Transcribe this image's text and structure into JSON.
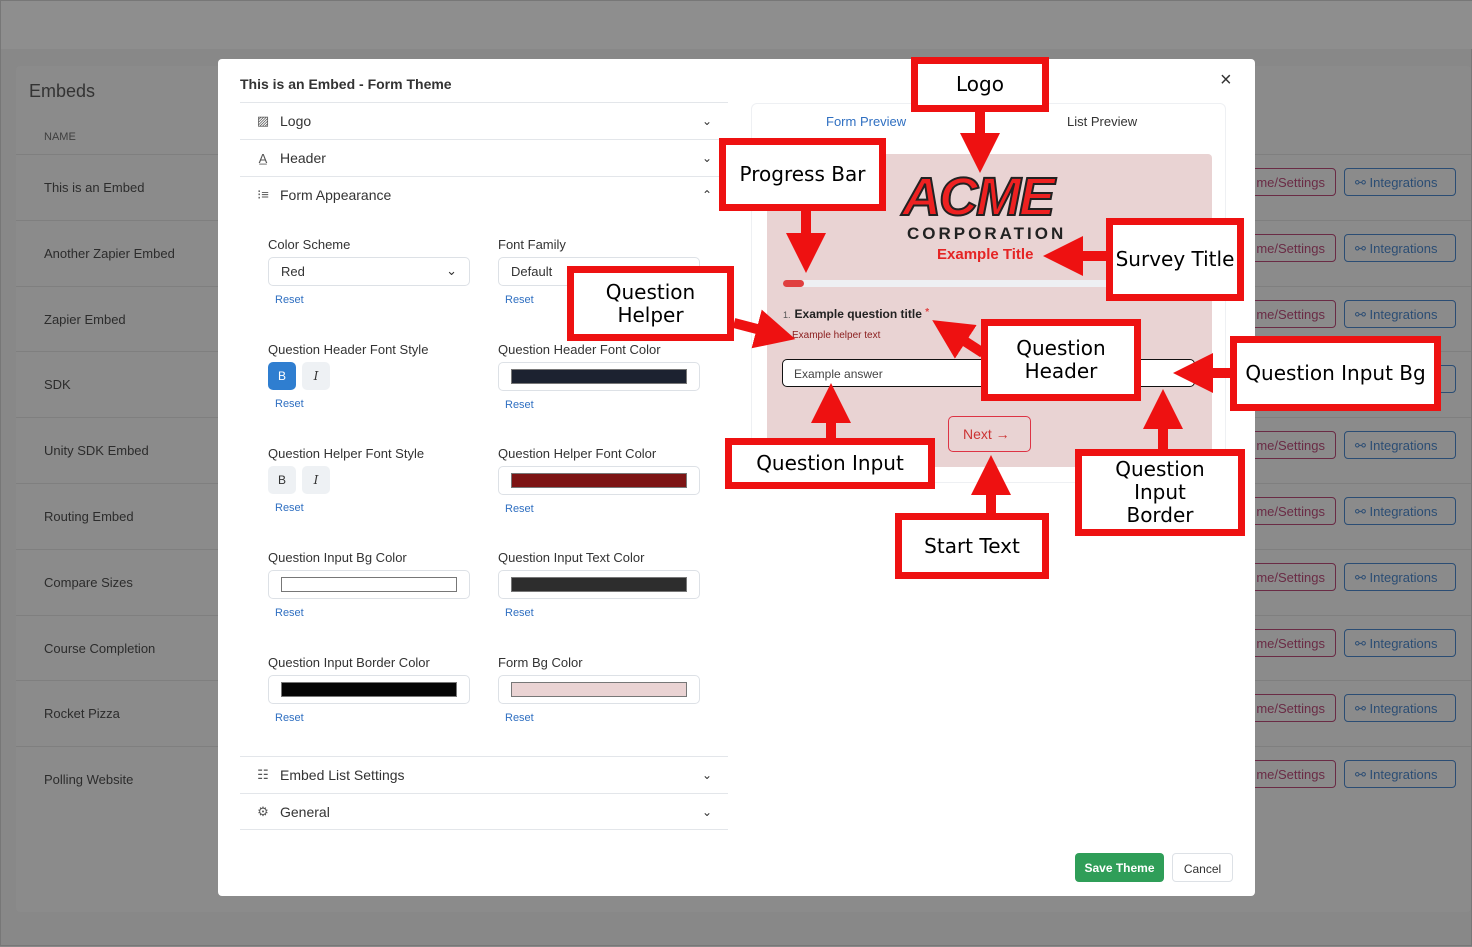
{
  "background": {
    "title": "Embeds",
    "column_name": "NAME",
    "rows": [
      "This is an Embed",
      "Another Zapier Embed",
      "Zapier Embed",
      "SDK",
      "Unity SDK Embed",
      "Routing Embed",
      "Compare Sizes",
      "Course Completion",
      "Rocket Pizza",
      "Polling Website"
    ],
    "theme_button": "me/Settings",
    "integrations_button": "Integrations"
  },
  "modal": {
    "title": "This is an Embed - Form Theme",
    "close": "×",
    "sections": [
      {
        "label": "Logo",
        "icon": "image-icon",
        "chev": "⌄"
      },
      {
        "label": "Header",
        "icon": "text-icon",
        "chev": "⌄"
      },
      {
        "label": "Form Appearance",
        "icon": "form-icon",
        "chev": "⌃"
      },
      {
        "label": "Embed List Settings",
        "icon": "list-icon",
        "chev": "⌄"
      },
      {
        "label": "General",
        "icon": "gear-icon",
        "chev": "⌄"
      }
    ],
    "reset": "Reset",
    "color_scheme": {
      "label": "Color Scheme",
      "value": "Red"
    },
    "font_family": {
      "label": "Font Family",
      "value": "Default"
    },
    "qh_style": {
      "label": "Question Header Font Style",
      "bold": "B",
      "italic": "I",
      "bold_on": true
    },
    "qh_color": {
      "label": "Question Header Font Color",
      "color": "#1c2230"
    },
    "qhelp_style": {
      "label": "Question Helper Font Style",
      "bold": "B",
      "italic": "I",
      "bold_on": false
    },
    "qhelp_color": {
      "label": "Question Helper Font Color",
      "color": "#7d1414"
    },
    "qin_bg": {
      "label": "Question Input Bg Color",
      "color": "#ffffff"
    },
    "qin_text": {
      "label": "Question Input Text Color",
      "color": "#2d2d2d"
    },
    "qin_border": {
      "label": "Question Input Border Color",
      "color": "#050505"
    },
    "form_bg": {
      "label": "Form Bg Color",
      "color": "#ead3d3"
    },
    "save": "Save Theme",
    "cancel": "Cancel"
  },
  "preview": {
    "tabs": [
      "Form Preview",
      "List Preview"
    ],
    "active_tab": "Form Preview",
    "logo": "ACME",
    "logo_sub": "CORPORATION",
    "title": "Example Title",
    "progress": 0.05,
    "question_number": "1.",
    "question_title": "Example question title",
    "required": "*",
    "helper": "Example helper text",
    "answer": "Example answer",
    "next": "Next →"
  },
  "annotations": [
    "Logo",
    "Progress Bar",
    "Survey Title",
    "Question Helper",
    "Question Header",
    "Question Input Bg",
    "Question Input",
    "Question Input Border",
    "Start Text"
  ],
  "colors": {
    "annotation": "#ee1111",
    "save": "#2f9e58",
    "link": "#2f6fc1"
  }
}
